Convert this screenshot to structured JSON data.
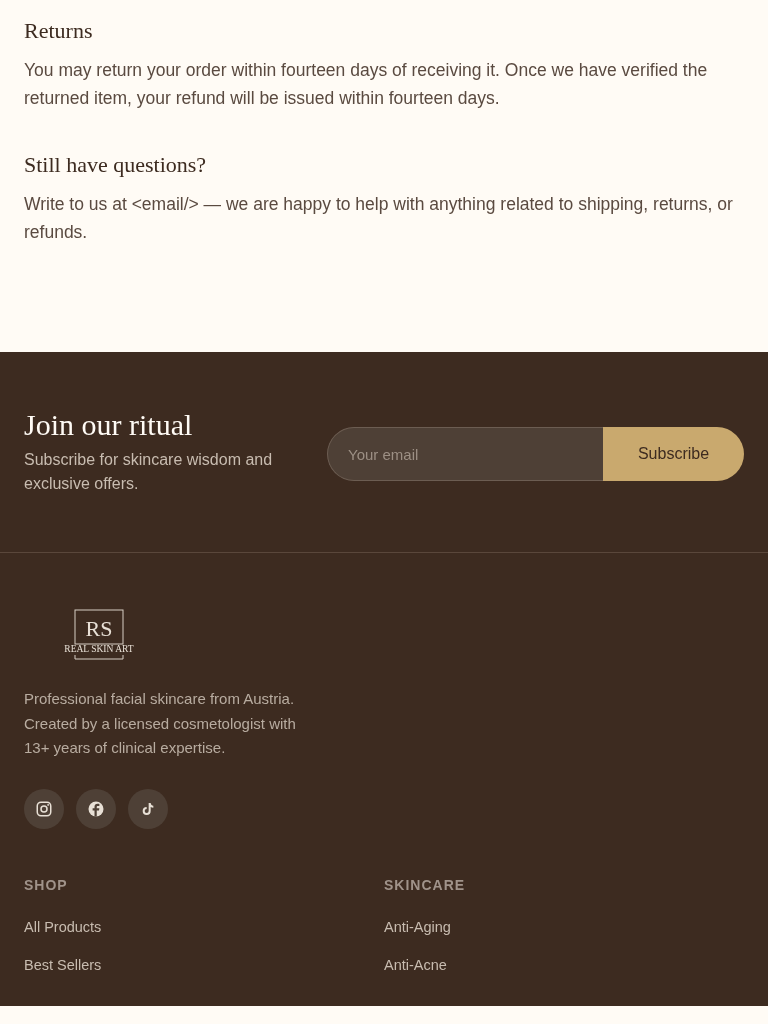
{
  "sections": [
    {
      "heading": "Returns",
      "body": "You may return your order within fourteen days of receiving it. Once we have verified the returned item, your refund will be issued within fourteen days."
    },
    {
      "heading": "Still have questions?",
      "body": "Write to us at <email/> — we are happy to help with anything related to shipping, returns, or refunds."
    }
  ],
  "newsletter": {
    "title": "Join our ritual",
    "subtitle": "Subscribe for skincare wisdom and exclusive offers.",
    "placeholder": "Your email",
    "button": "Subscribe"
  },
  "footer": {
    "logo": {
      "monogram": "RS",
      "wordmark": "REAL SKIN ART"
    },
    "about": "Professional facial skincare from Austria. Created by a licensed cosmetologist with 13+ years of clinical expertise.",
    "social": [
      {
        "kind": "instagram"
      },
      {
        "kind": "facebook"
      },
      {
        "kind": "tiktok"
      }
    ],
    "columns": [
      {
        "title": "SHOP",
        "links": [
          "All Products",
          "Best Sellers"
        ]
      },
      {
        "title": "SKINCARE",
        "links": [
          "Anti-Aging",
          "Anti-Acne"
        ]
      }
    ]
  }
}
